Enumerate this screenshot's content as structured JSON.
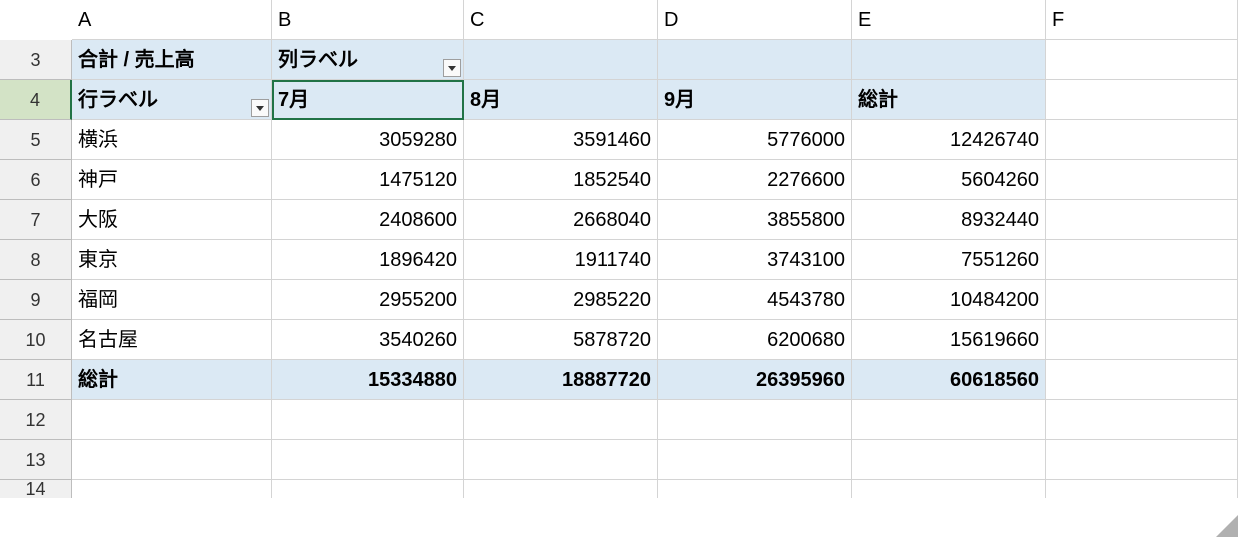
{
  "columns": [
    "A",
    "B",
    "C",
    "D",
    "E",
    "F"
  ],
  "row_numbers": [
    "3",
    "4",
    "5",
    "6",
    "7",
    "8",
    "9",
    "10",
    "11",
    "12",
    "13",
    "14"
  ],
  "selected_col_index": 1,
  "selected_row_index": 1,
  "pivot": {
    "value_field": "合計 / 売上高",
    "col_header_label": "列ラベル",
    "row_header_label": "行ラベル",
    "col_labels": [
      "7月",
      "8月",
      "9月"
    ],
    "grand_total_label": "総計",
    "rows": [
      {
        "label": "横浜",
        "values": [
          "3059280",
          "3591460",
          "5776000",
          "12426740"
        ]
      },
      {
        "label": "神戸",
        "values": [
          "1475120",
          "1852540",
          "2276600",
          "5604260"
        ]
      },
      {
        "label": "大阪",
        "values": [
          "2408600",
          "2668040",
          "3855800",
          "8932440"
        ]
      },
      {
        "label": "東京",
        "values": [
          "1896420",
          "1911740",
          "3743100",
          "7551260"
        ]
      },
      {
        "label": "福岡",
        "values": [
          "2955200",
          "2985220",
          "4543780",
          "10484200"
        ]
      },
      {
        "label": "名古屋",
        "values": [
          "3540260",
          "5878720",
          "6200680",
          "15619660"
        ]
      }
    ],
    "grand_total_row": [
      "15334880",
      "18887720",
      "26395960",
      "60618560"
    ]
  }
}
